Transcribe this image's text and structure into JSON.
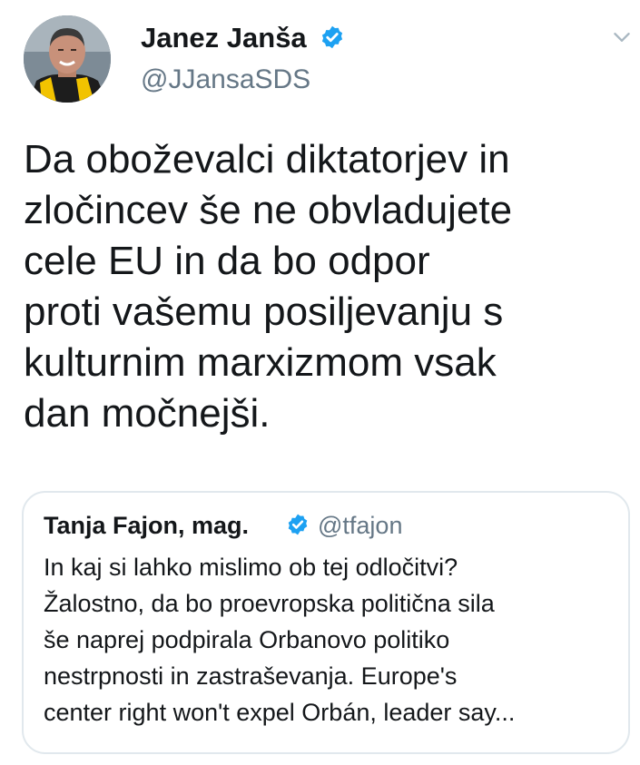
{
  "tweet": {
    "author": {
      "name": "Janez Janša",
      "handle": "@JJansaSDS",
      "avatar_icon": "profile-photo",
      "verified_icon": "verified-badge-icon"
    },
    "menu_icon": "chevron-down-icon",
    "text_lines": [
      "Da oboževalci diktatorjev in",
      "zločincev še ne obvladujete",
      "cele EU in da bo odpor",
      "proti vašemu posiljevanju s",
      "kulturnim marxizmom vsak",
      "dan močnejši."
    ]
  },
  "quoted_tweet": {
    "author": {
      "name": "Tanja Fajon, mag.",
      "handle": "@tfajon",
      "verified_icon": "verified-badge-icon"
    },
    "text_lines": [
      "In kaj si lahko mislimo ob tej odločitvi?",
      "Žalostno, da bo proevropska politična sila",
      "še naprej podpirala Orbanovo politiko",
      "nestrpnosti in zastraševanja. Europe's",
      "center right won't expel Orbán, leader say..."
    ]
  },
  "colors": {
    "text": "#14171a",
    "secondary_text": "#657786",
    "verified_blue": "#1da1f2",
    "border": "#e1e8ed",
    "caret": "#aab8c2"
  }
}
